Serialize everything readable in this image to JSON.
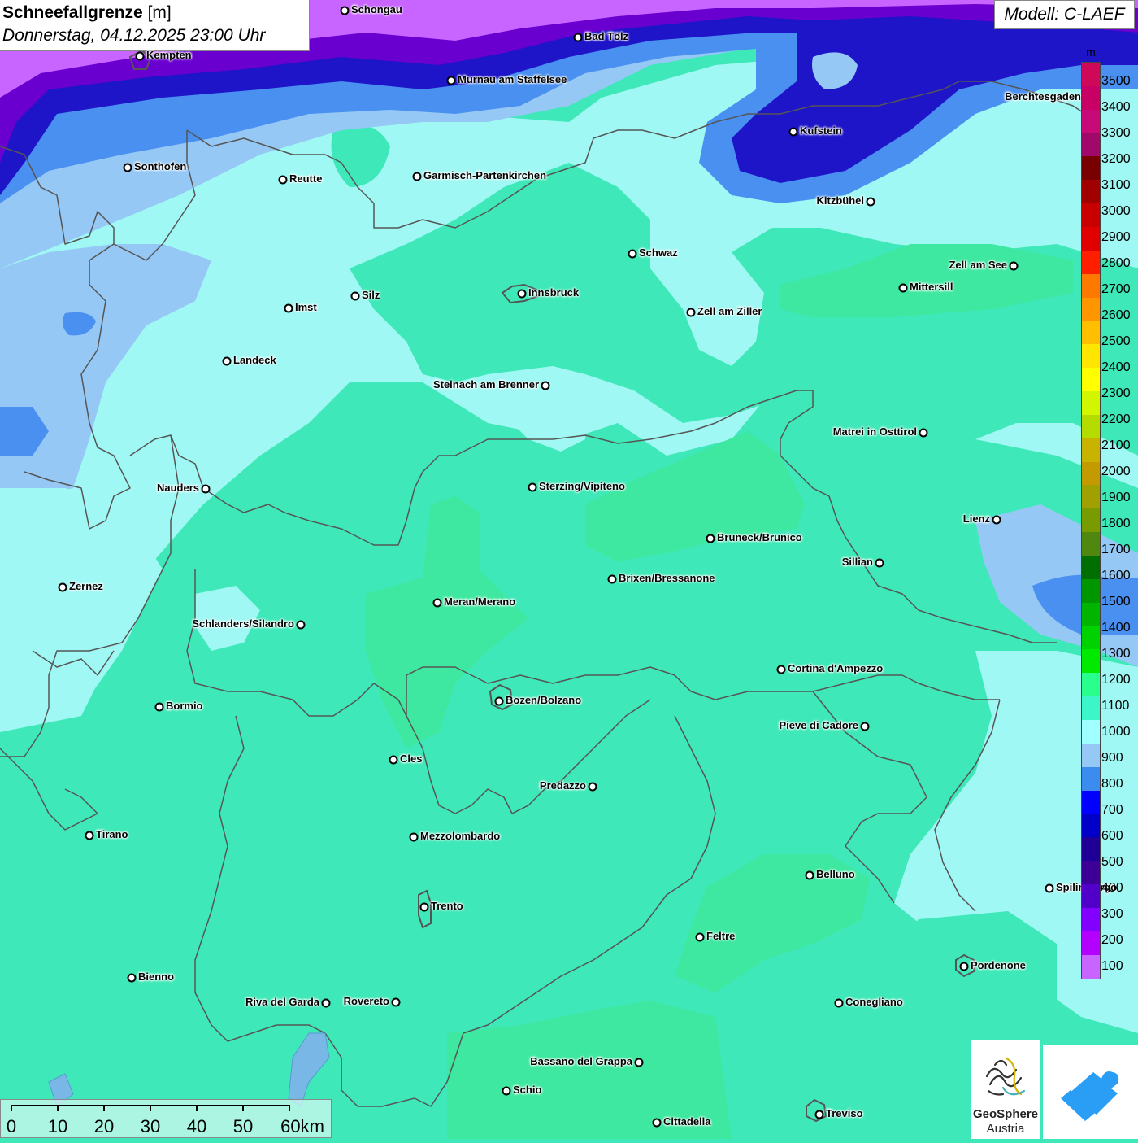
{
  "header": {
    "title": "Schneefallgrenze",
    "unit": "[m]",
    "datetime": "Donnerstag, 04.12.2025 23:00 Uhr",
    "model": "Modell: C-LAEF"
  },
  "legend": {
    "unit": "m",
    "levels": [
      "3500",
      "3400",
      "3300",
      "3200",
      "3100",
      "3000",
      "2900",
      "2800",
      "2700",
      "2600",
      "2500",
      "2400",
      "2300",
      "2200",
      "2100",
      "2000",
      "1900",
      "1800",
      "1700",
      "1600",
      "1500",
      "1400",
      "1300",
      "1200",
      "1100",
      "1000",
      "900",
      "800",
      "700",
      "600",
      "500",
      "400",
      "300",
      "200",
      "100"
    ],
    "colors": [
      "#d0085a",
      "#c80066",
      "#c80a78",
      "#a0086a",
      "#780000",
      "#a00000",
      "#c80000",
      "#e10000",
      "#ff1e00",
      "#ff7800",
      "#ff9600",
      "#ffbe00",
      "#ffe600",
      "#ffff00",
      "#d2f500",
      "#b4dc00",
      "#c8b400",
      "#c39b00",
      "#a0a000",
      "#789b00",
      "#50870f",
      "#006e00",
      "#009600",
      "#00b400",
      "#00d200",
      "#00ea00",
      "#28ff8c",
      "#3cf5c8",
      "#a0ffff",
      "#96c8f5",
      "#3c8cf0",
      "#0000ff",
      "#0000c8",
      "#1e0096",
      "#3c0096",
      "#5000c8",
      "#8200ff",
      "#b400ff",
      "#c864ff"
    ]
  },
  "places": [
    {
      "name": "Schongau",
      "label_side": "right"
    },
    {
      "name": "Bad Tölz",
      "label_side": "right"
    },
    {
      "name": "Kempten",
      "label_side": "right"
    },
    {
      "name": "Murnau am Staffelsee",
      "label_side": "right"
    },
    {
      "name": "Sonthofen",
      "label_side": "right"
    },
    {
      "name": "Reutte",
      "label_side": "right"
    },
    {
      "name": "Garmisch-Partenkirchen",
      "label_side": "right"
    },
    {
      "name": "Kufstein",
      "label_side": "right"
    },
    {
      "name": "Berchtesgaden",
      "label_side": "left"
    },
    {
      "name": "Kitzbühel",
      "label_side": "left"
    },
    {
      "name": "Schwaz",
      "label_side": "right"
    },
    {
      "name": "Zell am See",
      "label_side": "left"
    },
    {
      "name": "Innsbruck",
      "label_side": "right"
    },
    {
      "name": "Silz",
      "label_side": "right"
    },
    {
      "name": "Imst",
      "label_side": "right"
    },
    {
      "name": "Mittersill",
      "label_side": "right"
    },
    {
      "name": "Zell am Ziller",
      "label_side": "right"
    },
    {
      "name": "Landeck",
      "label_side": "right"
    },
    {
      "name": "Steinach am Brenner",
      "label_side": "left"
    },
    {
      "name": "Matrei in Osttirol",
      "label_side": "left"
    },
    {
      "name": "Nauders",
      "label_side": "left"
    },
    {
      "name": "Sterzing/Vipiteno",
      "label_side": "right"
    },
    {
      "name": "Lienz",
      "label_side": "left"
    },
    {
      "name": "Bruneck/Brunico",
      "label_side": "right"
    },
    {
      "name": "Sillian",
      "label_side": "left"
    },
    {
      "name": "Brixen/Bressanone",
      "label_side": "right"
    },
    {
      "name": "Zernez",
      "label_side": "right"
    },
    {
      "name": "Meran/Merano",
      "label_side": "right"
    },
    {
      "name": "Schlanders/Silandro",
      "label_side": "left"
    },
    {
      "name": "Cortina d'Ampezzo",
      "label_side": "right"
    },
    {
      "name": "Bozen/Bolzano",
      "label_side": "right"
    },
    {
      "name": "Bormio",
      "label_side": "right"
    },
    {
      "name": "Pieve di Cadore",
      "label_side": "left"
    },
    {
      "name": "Cles",
      "label_side": "right"
    },
    {
      "name": "Predazzo",
      "label_side": "left"
    },
    {
      "name": "Tirano",
      "label_side": "right"
    },
    {
      "name": "Mezzolombardo",
      "label_side": "right"
    },
    {
      "name": "Belluno",
      "label_side": "right"
    },
    {
      "name": "Spilimbergo",
      "label_side": "right"
    },
    {
      "name": "Trento",
      "label_side": "right"
    },
    {
      "name": "Feltre",
      "label_side": "right"
    },
    {
      "name": "Pordenone",
      "label_side": "right"
    },
    {
      "name": "Bienno",
      "label_side": "right"
    },
    {
      "name": "Riva del Garda",
      "label_side": "left"
    },
    {
      "name": "Rovereto",
      "label_side": "left"
    },
    {
      "name": "Conegliano",
      "label_side": "right"
    },
    {
      "name": "Bassano del Grappa",
      "label_side": "left"
    },
    {
      "name": "Schio",
      "label_side": "right"
    },
    {
      "name": "Treviso",
      "label_side": "right"
    },
    {
      "name": "Cittadella",
      "label_side": "right"
    }
  ],
  "scale_bar": {
    "labels": [
      "0",
      "10",
      "20",
      "30",
      "40",
      "50",
      "60km"
    ]
  },
  "logos": {
    "geosphere_line1": "GeoSphere",
    "geosphere_line2": "Austria"
  },
  "colors": {
    "band_100_200": "#c864ff",
    "band_300_400": "#6a00d0",
    "band_500_600": "#1e14c8",
    "band_800_900": "#4a90f0",
    "band_900_1000": "#96c8f5",
    "band_1000_1100": "#9ff7f0",
    "band_1100_1200": "#3fe8b8",
    "band_1200_1300": "#3ee8a0",
    "cloud_logo_blue": "#2a9df4"
  }
}
